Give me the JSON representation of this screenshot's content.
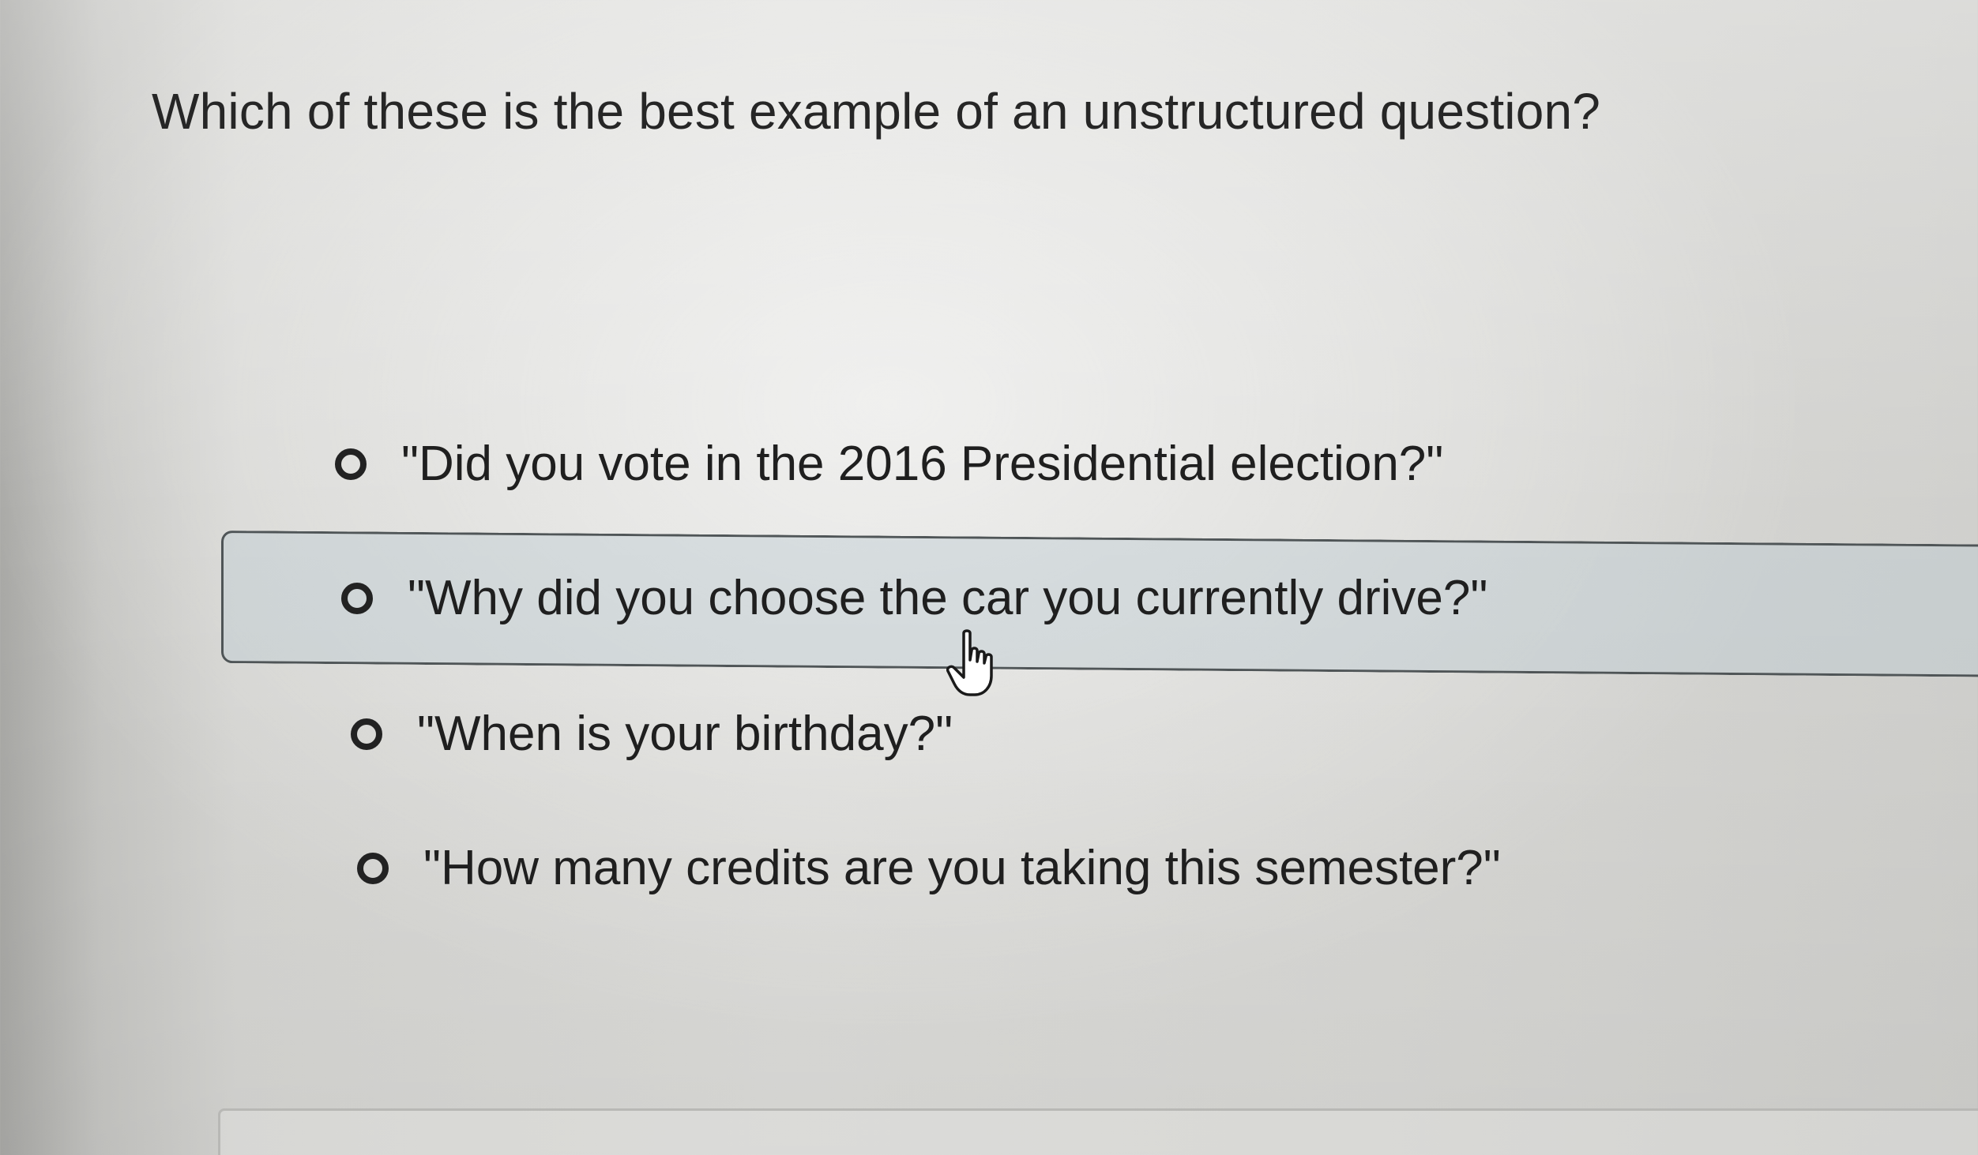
{
  "question": {
    "text": "Which of these is the best example of an unstructured question?"
  },
  "options": [
    {
      "label": "\"Did you vote in the 2016 Presidential election?\"",
      "selected": false
    },
    {
      "label": "\"Why did you choose the car you currently drive?\"",
      "selected": false,
      "hovered": true
    },
    {
      "label": "\"When is your birthday?\"",
      "selected": false
    },
    {
      "label": "\"How many credits are you taking this semester?\"",
      "selected": false
    }
  ],
  "cursor": {
    "icon": "hand-pointer-icon"
  }
}
